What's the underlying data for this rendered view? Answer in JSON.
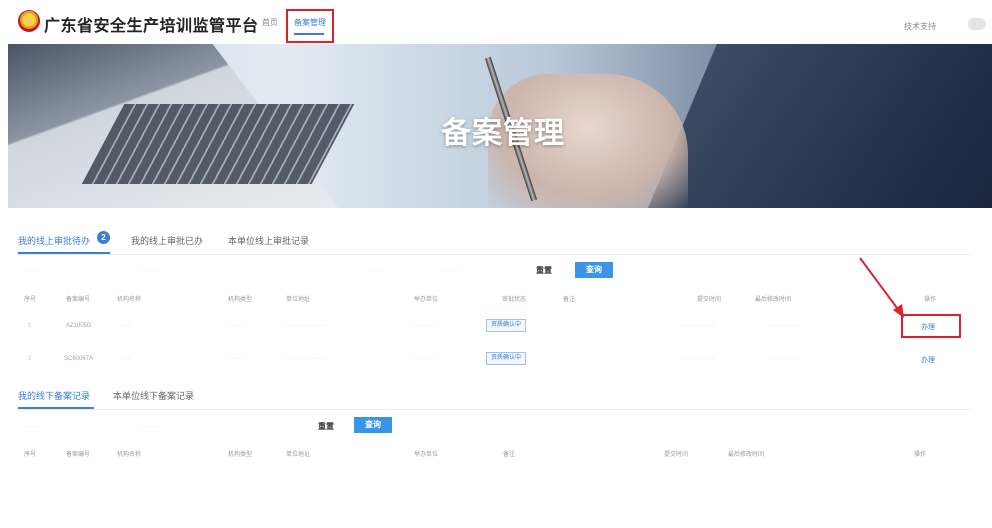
{
  "header": {
    "site_title": "广东省安全生产培训监管平台",
    "nav_home": "首页",
    "nav_record": "备案管理",
    "tech_support": "技术支持"
  },
  "banner": {
    "title": "备案管理"
  },
  "online": {
    "tabs": [
      {
        "label": "我的线上审批待办",
        "active": true,
        "badge": "2"
      },
      {
        "label": "我的线上审批已办",
        "active": false
      },
      {
        "label": "本单位线上审批记录",
        "active": false
      }
    ],
    "reset_label": "重置",
    "query_label": "查询",
    "columns": [
      "序号",
      "备案编号",
      "机构名称",
      "机构类型",
      "单位地址",
      "举办单位",
      "审批状态",
      "备注",
      "提交时间",
      "最后修改时间",
      "操作"
    ],
    "rows": [
      {
        "no": "1",
        "code": "AZ1005D",
        "status": "资质确认中",
        "action": "办理"
      },
      {
        "no": "2",
        "code": "SC60067A",
        "status": "资质确认中",
        "action": "办理"
      }
    ]
  },
  "offline": {
    "tabs": [
      {
        "label": "我的线下备案记录",
        "active": true
      },
      {
        "label": "本单位线下备案记录",
        "active": false
      }
    ],
    "reset_label": "重置",
    "query_label": "查询",
    "columns": [
      "序号",
      "备案编号",
      "机构名称",
      "机构类型",
      "单位地址",
      "举办单位",
      "备注",
      "提交时间",
      "最后修改时间",
      "操作"
    ]
  },
  "colors": {
    "accent": "#3a7fd5",
    "query_button": "#3a95e6",
    "highlight": "#d9232d"
  }
}
